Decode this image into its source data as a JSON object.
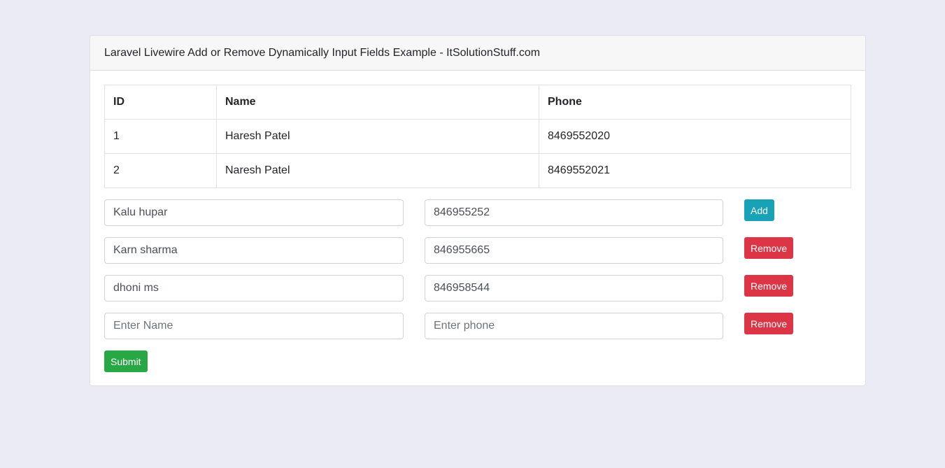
{
  "header": {
    "title": "Laravel Livewire Add or Remove Dynamically Input Fields Example - ItSolutionStuff.com"
  },
  "table": {
    "columns": [
      "ID",
      "Name",
      "Phone"
    ],
    "rows": [
      {
        "id": "1",
        "name": "Haresh Patel",
        "phone": "8469552020"
      },
      {
        "id": "2",
        "name": "Naresh Patel",
        "phone": "8469552021"
      }
    ]
  },
  "form": {
    "rows": [
      {
        "name_value": "Kalu hupar",
        "name_placeholder": "Enter Name",
        "phone_value": "846955252",
        "phone_placeholder": "Enter phone",
        "button_label": "Add",
        "button_type": "add"
      },
      {
        "name_value": "Karn sharma",
        "name_placeholder": "Enter Name",
        "phone_value": "846955665",
        "phone_placeholder": "Enter phone",
        "button_label": "Remove",
        "button_type": "remove"
      },
      {
        "name_value": "dhoni ms",
        "name_placeholder": "Enter Name",
        "phone_value": "846958544",
        "phone_placeholder": "Enter phone",
        "button_label": "Remove",
        "button_type": "remove"
      },
      {
        "name_value": "",
        "name_placeholder": "Enter Name",
        "phone_value": "",
        "phone_placeholder": "Enter phone",
        "button_label": "Remove",
        "button_type": "remove"
      }
    ],
    "submit_label": "Submit"
  },
  "colors": {
    "add": "#17a2b8",
    "remove": "#dc3545",
    "submit": "#28a745",
    "page_background": "#ebebf5"
  }
}
